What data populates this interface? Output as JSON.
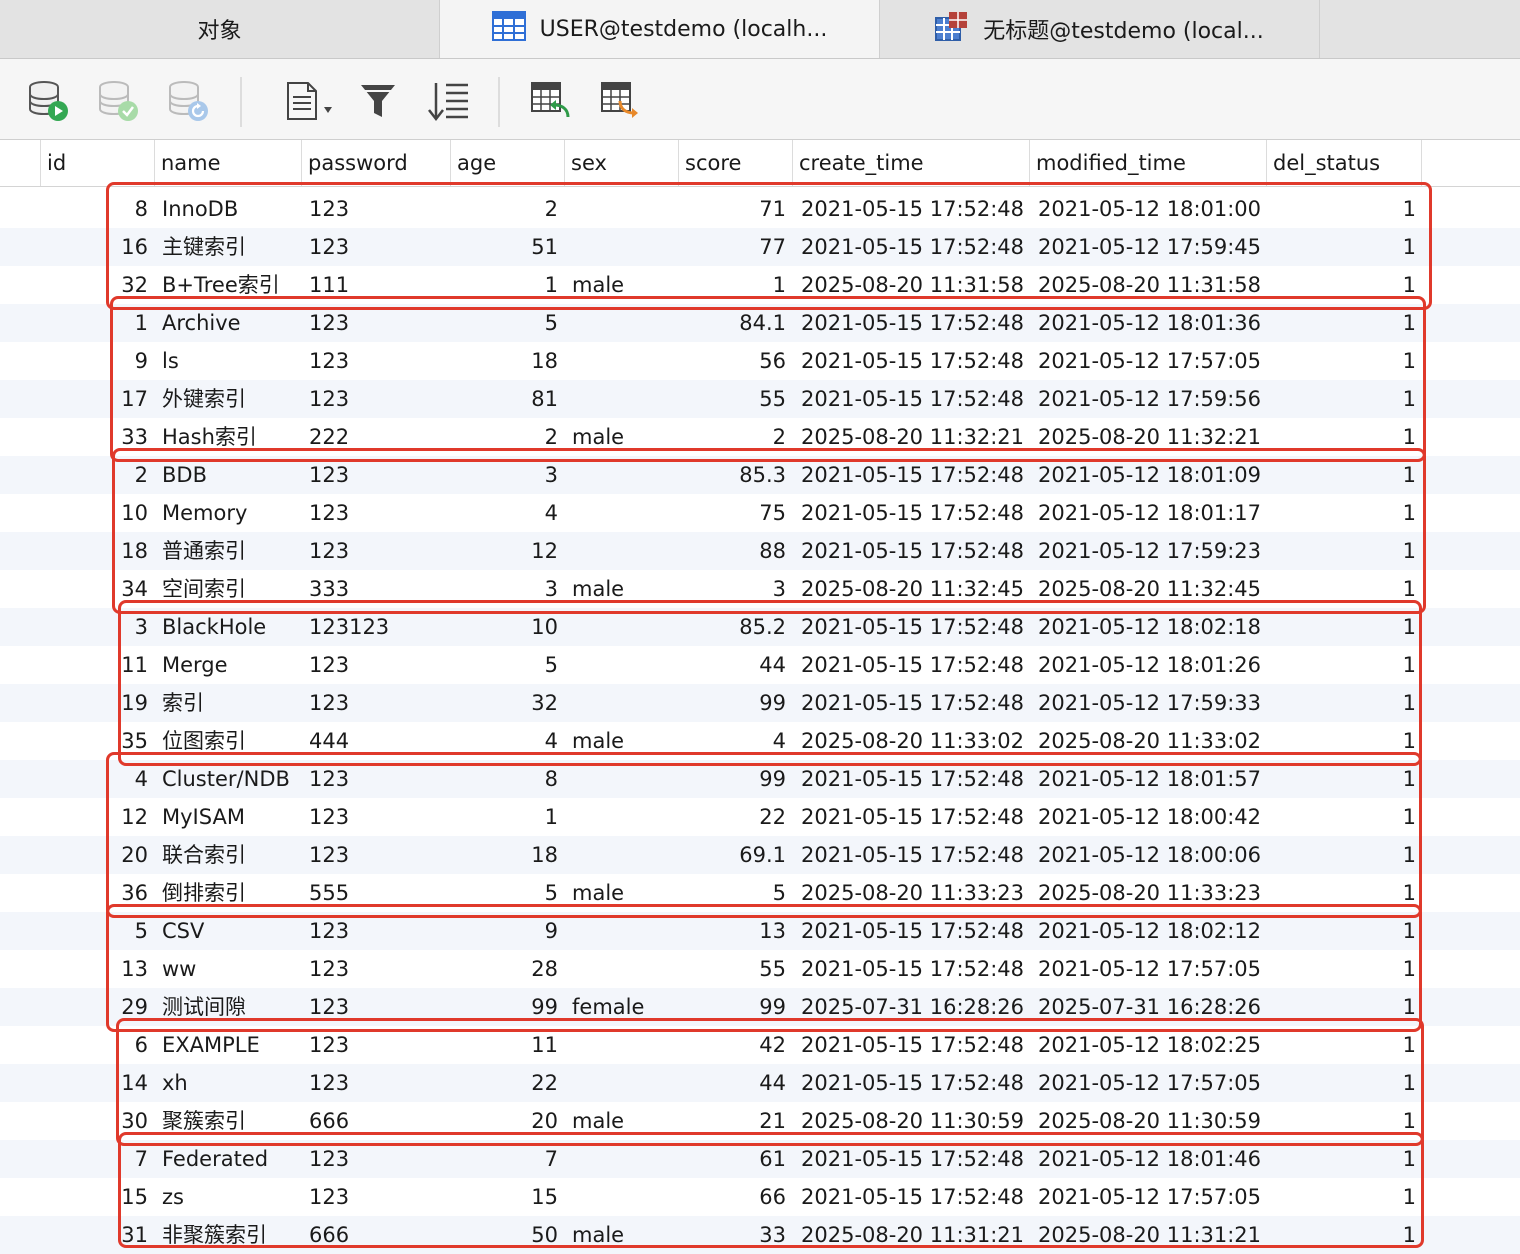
{
  "tabs": [
    {
      "label": "对象",
      "active": false,
      "icon": ""
    },
    {
      "label": "USER@testdemo (localh...",
      "active": true,
      "icon": "table-icon"
    },
    {
      "label": "无标题@testdemo (local...",
      "active": false,
      "icon": "query-icon"
    }
  ],
  "toolbar": {
    "icons": [
      "begin-transaction-icon",
      "commit-icon",
      "rollback-icon",
      "text-view-icon",
      "filter-icon",
      "sort-icon",
      "import-icon",
      "export-icon"
    ]
  },
  "columns": [
    "id",
    "name",
    "password",
    "age",
    "sex",
    "score",
    "create_time",
    "modified_time",
    "del_status"
  ],
  "rows": [
    {
      "id": "8",
      "name": "InnoDB",
      "password": "123",
      "age": "2",
      "sex": "",
      "score": "71",
      "create_time": "2021-05-15 17:52:48",
      "modified_time": "2021-05-12 18:01:00",
      "del_status": "1"
    },
    {
      "id": "16",
      "name": "主键索引",
      "password": "123",
      "age": "51",
      "sex": "",
      "score": "77",
      "create_time": "2021-05-15 17:52:48",
      "modified_time": "2021-05-12 17:59:45",
      "del_status": "1"
    },
    {
      "id": "32",
      "name": "B+Tree索引",
      "password": "111",
      "age": "1",
      "sex": "male",
      "score": "1",
      "create_time": "2025-08-20 11:31:58",
      "modified_time": "2025-08-20 11:31:58",
      "del_status": "1"
    },
    {
      "id": "1",
      "name": "Archive",
      "password": "123",
      "age": "5",
      "sex": "",
      "score": "84.1",
      "create_time": "2021-05-15 17:52:48",
      "modified_time": "2021-05-12 18:01:36",
      "del_status": "1"
    },
    {
      "id": "9",
      "name": "ls",
      "password": "123",
      "age": "18",
      "sex": "",
      "score": "56",
      "create_time": "2021-05-15 17:52:48",
      "modified_time": "2021-05-12 17:57:05",
      "del_status": "1"
    },
    {
      "id": "17",
      "name": "外键索引",
      "password": "123",
      "age": "81",
      "sex": "",
      "score": "55",
      "create_time": "2021-05-15 17:52:48",
      "modified_time": "2021-05-12 17:59:56",
      "del_status": "1"
    },
    {
      "id": "33",
      "name": "Hash索引",
      "password": "222",
      "age": "2",
      "sex": "male",
      "score": "2",
      "create_time": "2025-08-20 11:32:21",
      "modified_time": "2025-08-20 11:32:21",
      "del_status": "1"
    },
    {
      "id": "2",
      "name": "BDB",
      "password": "123",
      "age": "3",
      "sex": "",
      "score": "85.3",
      "create_time": "2021-05-15 17:52:48",
      "modified_time": "2021-05-12 18:01:09",
      "del_status": "1"
    },
    {
      "id": "10",
      "name": "Memory",
      "password": "123",
      "age": "4",
      "sex": "",
      "score": "75",
      "create_time": "2021-05-15 17:52:48",
      "modified_time": "2021-05-12 18:01:17",
      "del_status": "1"
    },
    {
      "id": "18",
      "name": "普通索引",
      "password": "123",
      "age": "12",
      "sex": "",
      "score": "88",
      "create_time": "2021-05-15 17:52:48",
      "modified_time": "2021-05-12 17:59:23",
      "del_status": "1"
    },
    {
      "id": "34",
      "name": "空间索引",
      "password": "333",
      "age": "3",
      "sex": "male",
      "score": "3",
      "create_time": "2025-08-20 11:32:45",
      "modified_time": "2025-08-20 11:32:45",
      "del_status": "1"
    },
    {
      "id": "3",
      "name": "BlackHole",
      "password": "123123",
      "age": "10",
      "sex": "",
      "score": "85.2",
      "create_time": "2021-05-15 17:52:48",
      "modified_time": "2021-05-12 18:02:18",
      "del_status": "1"
    },
    {
      "id": "11",
      "name": "Merge",
      "password": "123",
      "age": "5",
      "sex": "",
      "score": "44",
      "create_time": "2021-05-15 17:52:48",
      "modified_time": "2021-05-12 18:01:26",
      "del_status": "1"
    },
    {
      "id": "19",
      "name": "索引",
      "password": "123",
      "age": "32",
      "sex": "",
      "score": "99",
      "create_time": "2021-05-15 17:52:48",
      "modified_time": "2021-05-12 17:59:33",
      "del_status": "1"
    },
    {
      "id": "35",
      "name": "位图索引",
      "password": "444",
      "age": "4",
      "sex": "male",
      "score": "4",
      "create_time": "2025-08-20 11:33:02",
      "modified_time": "2025-08-20 11:33:02",
      "del_status": "1"
    },
    {
      "id": "4",
      "name": "Cluster/NDB",
      "password": "123",
      "age": "8",
      "sex": "",
      "score": "99",
      "create_time": "2021-05-15 17:52:48",
      "modified_time": "2021-05-12 18:01:57",
      "del_status": "1"
    },
    {
      "id": "12",
      "name": "MyISAM",
      "password": "123",
      "age": "1",
      "sex": "",
      "score": "22",
      "create_time": "2021-05-15 17:52:48",
      "modified_time": "2021-05-12 18:00:42",
      "del_status": "1"
    },
    {
      "id": "20",
      "name": "联合索引",
      "password": "123",
      "age": "18",
      "sex": "",
      "score": "69.1",
      "create_time": "2021-05-15 17:52:48",
      "modified_time": "2021-05-12 18:00:06",
      "del_status": "1"
    },
    {
      "id": "36",
      "name": "倒排索引",
      "password": "555",
      "age": "5",
      "sex": "male",
      "score": "5",
      "create_time": "2025-08-20 11:33:23",
      "modified_time": "2025-08-20 11:33:23",
      "del_status": "1"
    },
    {
      "id": "5",
      "name": "CSV",
      "password": "123",
      "age": "9",
      "sex": "",
      "score": "13",
      "create_time": "2021-05-15 17:52:48",
      "modified_time": "2021-05-12 18:02:12",
      "del_status": "1"
    },
    {
      "id": "13",
      "name": "ww",
      "password": "123",
      "age": "28",
      "sex": "",
      "score": "55",
      "create_time": "2021-05-15 17:52:48",
      "modified_time": "2021-05-12 17:57:05",
      "del_status": "1"
    },
    {
      "id": "29",
      "name": "测试间隙",
      "password": "123",
      "age": "99",
      "sex": "female",
      "score": "99",
      "create_time": "2025-07-31 16:28:26",
      "modified_time": "2025-07-31 16:28:26",
      "del_status": "1"
    },
    {
      "id": "6",
      "name": "EXAMPLE",
      "password": "123",
      "age": "11",
      "sex": "",
      "score": "42",
      "create_time": "2021-05-15 17:52:48",
      "modified_time": "2021-05-12 18:02:25",
      "del_status": "1"
    },
    {
      "id": "14",
      "name": "xh",
      "password": "123",
      "age": "22",
      "sex": "",
      "score": "44",
      "create_time": "2021-05-15 17:52:48",
      "modified_time": "2021-05-12 17:57:05",
      "del_status": "1"
    },
    {
      "id": "30",
      "name": "聚簇索引",
      "password": "666",
      "age": "20",
      "sex": "male",
      "score": "21",
      "create_time": "2025-08-20 11:30:59",
      "modified_time": "2025-08-20 11:30:59",
      "del_status": "1"
    },
    {
      "id": "7",
      "name": "Federated",
      "password": "123",
      "age": "7",
      "sex": "",
      "score": "61",
      "create_time": "2021-05-15 17:52:48",
      "modified_time": "2021-05-12 18:01:46",
      "del_status": "1"
    },
    {
      "id": "15",
      "name": "zs",
      "password": "123",
      "age": "15",
      "sex": "",
      "score": "66",
      "create_time": "2021-05-15 17:52:48",
      "modified_time": "2021-05-12 17:57:05",
      "del_status": "1"
    },
    {
      "id": "31",
      "name": "非聚簇索引",
      "password": "666",
      "age": "50",
      "sex": "male",
      "score": "33",
      "create_time": "2025-08-20 11:31:21",
      "modified_time": "2025-08-20 11:31:21",
      "del_status": "1"
    }
  ],
  "highlight_groups": [
    {
      "first_row": 0,
      "last_row": 2
    },
    {
      "first_row": 3,
      "last_row": 6
    },
    {
      "first_row": 7,
      "last_row": 10
    },
    {
      "first_row": 11,
      "last_row": 14
    },
    {
      "first_row": 15,
      "last_row": 18
    },
    {
      "first_row": 19,
      "last_row": 21
    },
    {
      "first_row": 22,
      "last_row": 24
    },
    {
      "first_row": 25,
      "last_row": 27
    }
  ],
  "colors": {
    "highlight_border": "#e0392b",
    "alt_row": "#f3f6fb",
    "accent_blue": "#2f6fd6"
  }
}
